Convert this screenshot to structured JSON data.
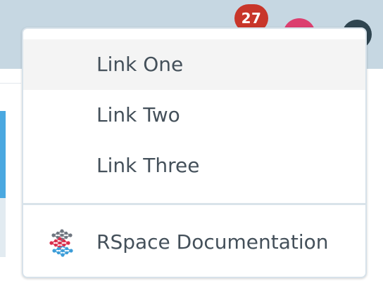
{
  "header": {
    "notification_count": "27",
    "colors": {
      "bar": "#c6d7e2",
      "badge": "#c8362a",
      "avatar": "#dc3f6f",
      "account": "#2f4550"
    }
  },
  "menu": {
    "items": [
      {
        "label": "Link One",
        "active": true
      },
      {
        "label": "Link Two",
        "active": false
      },
      {
        "label": "Link Three",
        "active": false
      }
    ],
    "footer_item": {
      "label": "RSpace Documentation",
      "icon": "rspace-logo-icon"
    },
    "colors": {
      "text": "#44505a",
      "hover": "#f4f4f4",
      "border": "#d7e2ea"
    }
  }
}
